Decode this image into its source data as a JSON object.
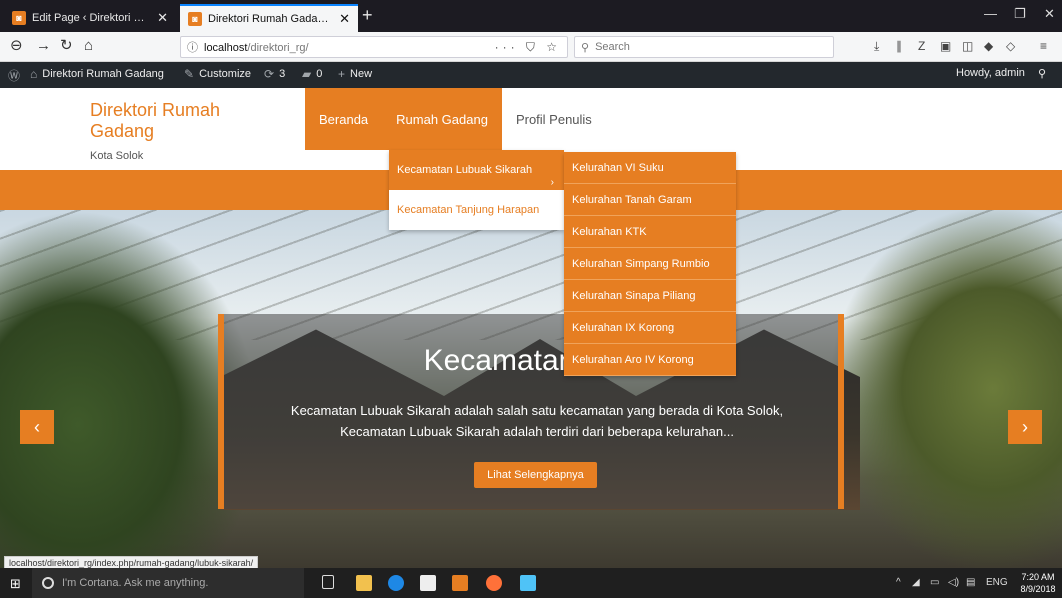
{
  "browser": {
    "tabs": [
      {
        "label": "Edit Page ‹ Direktori Rumah Ga",
        "close": "✕"
      },
      {
        "label": "Direktori Rumah Gadang – Kot",
        "close": "✕"
      }
    ],
    "new_tab": "+",
    "url_host": "localhost",
    "url_path": "/direktori_rg/",
    "page_actions": "··· ⛉ ☆",
    "search_placeholder": "Search"
  },
  "adminbar": {
    "site_name": "Direktori Rumah Gadang",
    "customize": "Customize",
    "updates_count": "3",
    "comments_count": "0",
    "new_label": "New",
    "howdy": "Howdy, admin"
  },
  "site": {
    "title": "Direktori Rumah Gadang",
    "description": "Kota Solok",
    "nav": [
      "Beranda",
      "Rumah Gadang",
      "Profil Penulis"
    ]
  },
  "dropdown_level1": [
    "Kecamatan Lubuak Sikarah",
    "Kecamatan Tanjung Harapan"
  ],
  "dropdown_level1_chevron": "›",
  "dropdown_level2": [
    "Kelurahan VI Suku",
    "Kelurahan Tanah Garam",
    "Kelurahan KTK",
    "Kelurahan Simpang Rumbio",
    "Kelurahan Sinapa Piliang",
    "Kelurahan IX Korong",
    "Kelurahan Aro IV Korong"
  ],
  "slider": {
    "title": "Kecamatan Lubu",
    "text_line1": "Kecamatan Lubuak Sikarah adalah salah satu kecamatan yang berada di Kota Solok,",
    "text_line2": "Kecamatan Lubuak Sikarah adalah terdiri dari beberapa kelurahan...",
    "button": "Lihat Selengkapnya",
    "prev": "‹",
    "next": "›"
  },
  "status_url": "localhost/direktori_rg/index.php/rumah-gadang/lubuk-sikarah/",
  "taskbar": {
    "cortana": "I'm Cortana. Ask me anything.",
    "lang": "ENG",
    "time": "7:20 AM",
    "date": "8/9/2018"
  },
  "colors": {
    "accent": "#e67e22",
    "adminbar": "#23282d",
    "tabbar": "#1c1b22"
  }
}
